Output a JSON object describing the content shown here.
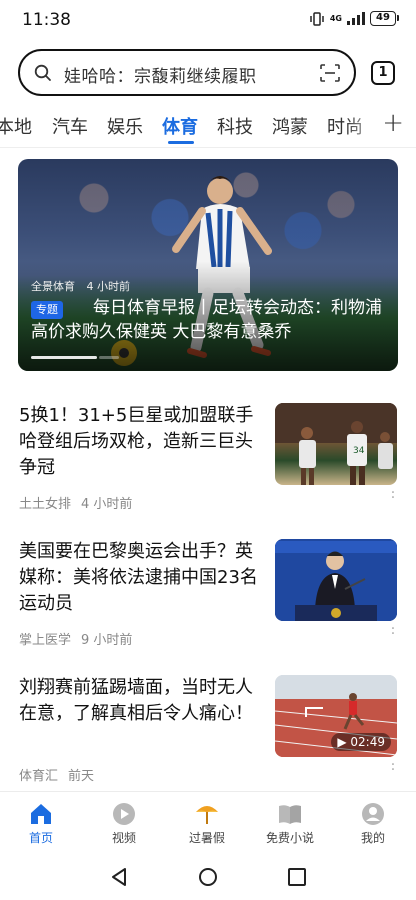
{
  "status_bar": {
    "time": "11:38",
    "network": "4G",
    "battery": "49"
  },
  "search": {
    "placeholder": "娃哈哈：宗馥莉继续履职",
    "tab_count": "1"
  },
  "channels": [
    {
      "label": "本地",
      "active": false
    },
    {
      "label": "汽车",
      "active": false
    },
    {
      "label": "娱乐",
      "active": false
    },
    {
      "label": "体育",
      "active": true
    },
    {
      "label": "科技",
      "active": false
    },
    {
      "label": "鸿蒙",
      "active": false
    },
    {
      "label": "时尚",
      "active": false
    }
  ],
  "hero": {
    "source": "全景体育",
    "time": "4 小时前",
    "badge": "专题",
    "title": "每日体育早报丨足坛转会动态：利物浦高价求购久保健英 大巴黎有意桑乔",
    "slide_position": 0.75
  },
  "news": [
    {
      "title": "5换1！31+5巨星或加盟联手哈登组后场双枪，造新三巨头争冠",
      "source": "土土女排",
      "time": "4 小时前",
      "thumb": "basketball-players-photo",
      "duration": ""
    },
    {
      "title": "美国要在巴黎奥运会出手？英媒称：美将依法逮捕中国23名运动员",
      "source": "掌上医学",
      "time": "9 小时前",
      "thumb": "press-conference-photo",
      "duration": ""
    },
    {
      "title": "刘翔赛前猛踢墙面，当时无人在意，了解真相后令人痛心！",
      "source": "体育汇",
      "time": "前天",
      "thumb": "hurdles-race-photo",
      "duration": "02:49"
    }
  ],
  "bottom_nav": [
    {
      "label": "首页",
      "icon": "home-icon",
      "active": true
    },
    {
      "label": "视频",
      "icon": "video-icon",
      "active": false
    },
    {
      "label": "过暑假",
      "icon": "umbrella-icon",
      "active": false
    },
    {
      "label": "免费小说",
      "icon": "book-icon",
      "active": false
    },
    {
      "label": "我的",
      "icon": "profile-icon",
      "active": false
    }
  ],
  "colors": {
    "accent": "#1b6ce0",
    "badge": "#1e66e6"
  }
}
